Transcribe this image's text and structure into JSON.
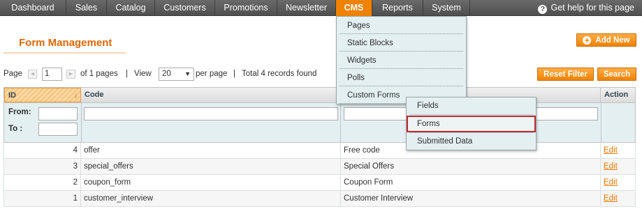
{
  "nav": {
    "items": [
      {
        "label": "Dashboard"
      },
      {
        "label": "Sales"
      },
      {
        "label": "Catalog"
      },
      {
        "label": "Customers"
      },
      {
        "label": "Promotions"
      },
      {
        "label": "Newsletter"
      },
      {
        "label": "CMS"
      },
      {
        "label": "Reports"
      },
      {
        "label": "System"
      }
    ],
    "help": "Get help for this page",
    "active": "CMS",
    "active_color": "#f18200"
  },
  "cms_menu": {
    "items": [
      "Pages",
      "Static Blocks",
      "Widgets",
      "Polls",
      "Custom Forms"
    ],
    "submenu": [
      "Fields",
      "Forms",
      "Submitted Data"
    ],
    "highlighted": "Forms"
  },
  "page": {
    "title": "Form Management",
    "add_button": "Add New"
  },
  "pager": {
    "page_label": "Page",
    "page_value": "1",
    "of_pages": "of 1 pages",
    "view_label": "View",
    "per_page_value": "20",
    "per_page_label": "per page",
    "total": "Total 4 records found",
    "reset_filter": "Reset Filter",
    "search": "Search"
  },
  "grid": {
    "columns": {
      "id": "ID",
      "code": "Code",
      "action": "Action"
    },
    "sort_arrow": "↓",
    "filter_from": "From:",
    "filter_to": "To :",
    "rows": [
      {
        "id": "4",
        "code": "offer",
        "title": "Free code",
        "action": "Edit"
      },
      {
        "id": "3",
        "code": "special_offers",
        "title": "Special Offers",
        "action": "Edit"
      },
      {
        "id": "2",
        "code": "coupon_form",
        "title": "Coupon Form",
        "action": "Edit"
      },
      {
        "id": "1",
        "code": "customer_interview",
        "title": "Customer Interview",
        "action": "Edit"
      }
    ]
  },
  "colors": {
    "accent": "#f18200",
    "title": "#e26703",
    "link": "#ea7601",
    "filter_bg": "#e3eff1",
    "highlight_border": "#c0282e"
  }
}
